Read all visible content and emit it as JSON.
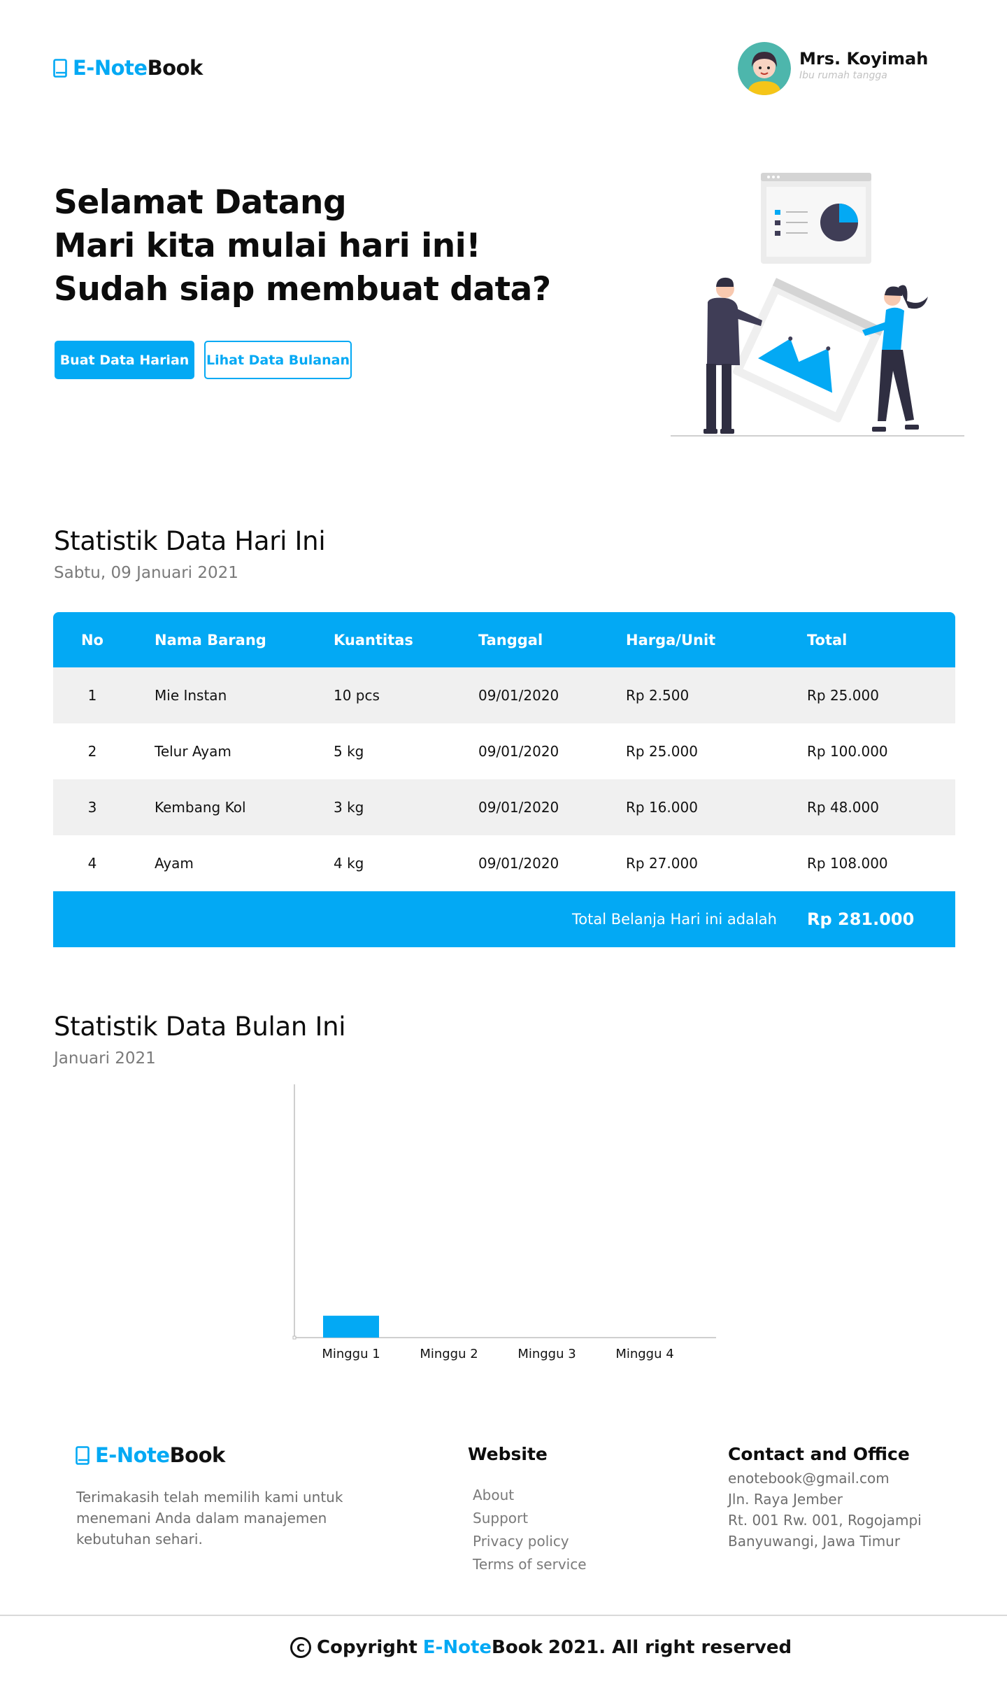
{
  "brand": {
    "name_part1": "E-Note",
    "name_part2": "Book"
  },
  "user": {
    "name": "Mrs. Koyimah",
    "role": "Ibu rumah tangga"
  },
  "hero": {
    "lines": [
      "Selamat Datang",
      "Mari kita mulai hari ini!",
      "Sudah siap membuat data?"
    ],
    "primary_button": "Buat Data Harian",
    "secondary_button": "Lihat Data Bulanan"
  },
  "daily": {
    "title": "Statistik Data Hari Ini",
    "date": "Sabtu, 09 Januari 2021",
    "columns": [
      "No",
      "Nama Barang",
      "Kuantitas",
      "Tanggal",
      "Harga/Unit",
      "Total"
    ],
    "rows": [
      [
        "1",
        "Mie Instan",
        "10 pcs",
        "09/01/2020",
        "Rp 2.500",
        "Rp 25.000"
      ],
      [
        "2",
        "Telur Ayam",
        "5 kg",
        "09/01/2020",
        "Rp 25.000",
        "Rp 100.000"
      ],
      [
        "3",
        "Kembang Kol",
        "3 kg",
        "09/01/2020",
        "Rp 16.000",
        "Rp 48.000"
      ],
      [
        "4",
        "Ayam",
        "4 kg",
        "09/01/2020",
        "Rp 27.000",
        "Rp 108.000"
      ]
    ],
    "total_label": "Total Belanja Hari ini adalah",
    "total_value": "Rp 281.000"
  },
  "monthly": {
    "title": "Statistik Data Bulan Ini",
    "month": "Januari 2021"
  },
  "chart_data": {
    "type": "bar",
    "categories": [
      "Minggu 1",
      "Minggu 2",
      "Minggu 3",
      "Minggu 4"
    ],
    "values": [
      281000,
      0,
      0,
      0
    ],
    "title": "",
    "xlabel": "",
    "ylabel": "",
    "ylim": [
      0,
      3250000
    ],
    "grid": false,
    "bar_color": "#03A9F4"
  },
  "footer": {
    "tagline": [
      "Terimakasih telah memilih kami untuk",
      "menemani Anda dalam manajemen",
      "kebutuhan sehari."
    ],
    "website_heading": "Website",
    "links": [
      "About",
      "Support",
      "Privacy policy",
      "Terms of service"
    ],
    "contact_heading": "Contact and Office",
    "contact_lines": [
      "enotebook@gmail.com",
      "Jln. Raya Jember",
      "Rt. 001 Rw. 001, Rogojampi",
      "Banyuwangi, Jawa Timur"
    ],
    "copyright_prefix": "Copyright",
    "copyright_suffix": "2021. All right reserved"
  },
  "colors": {
    "accent": "#03A9F4",
    "row_shade": "#f0f0f0",
    "text": "#111111"
  },
  "icons": [
    "book-icon",
    "copyright-icon"
  ]
}
